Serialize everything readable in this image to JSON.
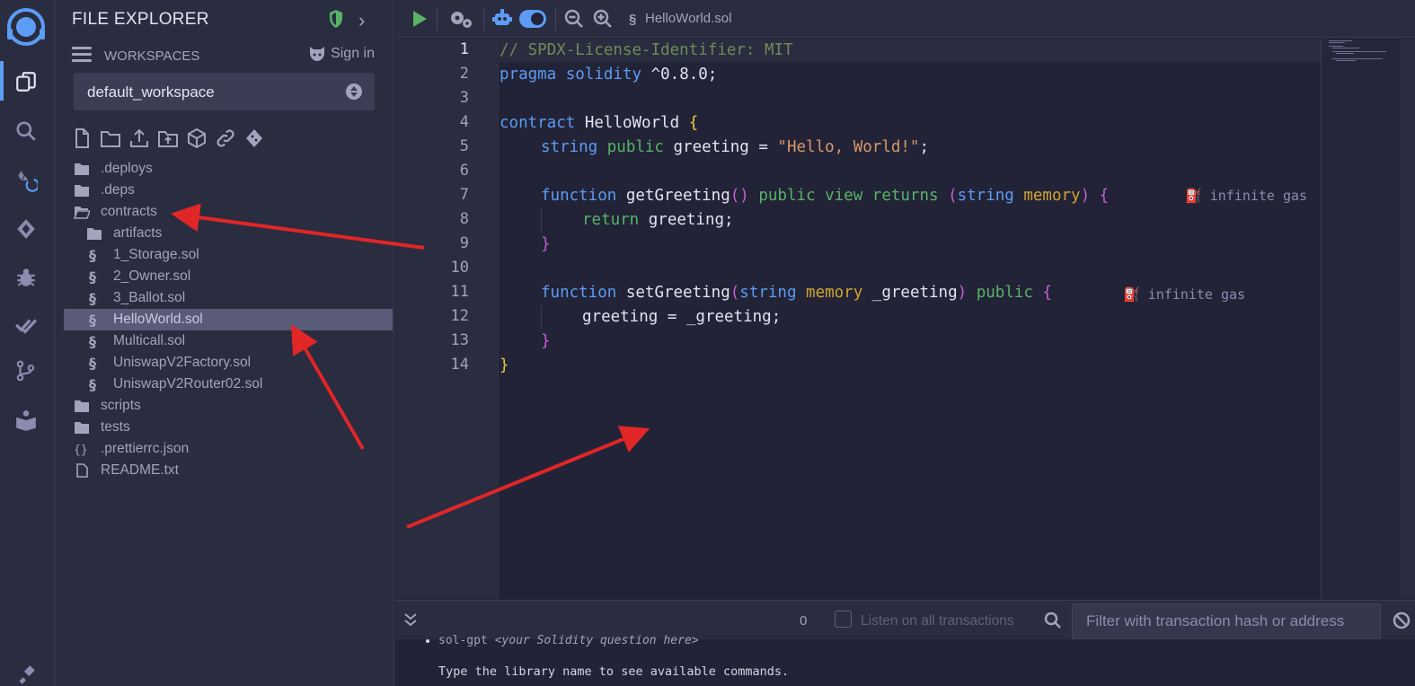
{
  "explorer": {
    "title": "FILE EXPLORER",
    "workspaces_label": "WORKSPACES",
    "sign_in": "Sign in",
    "workspace": "default_workspace"
  },
  "tree": [
    {
      "name": ".deploys",
      "type": "folder",
      "indent": 0
    },
    {
      "name": ".deps",
      "type": "folder",
      "indent": 0
    },
    {
      "name": "contracts",
      "type": "folder-open",
      "indent": 0
    },
    {
      "name": "artifacts",
      "type": "folder",
      "indent": 1
    },
    {
      "name": "1_Storage.sol",
      "type": "sol",
      "indent": 1
    },
    {
      "name": "2_Owner.sol",
      "type": "sol",
      "indent": 1
    },
    {
      "name": "3_Ballot.sol",
      "type": "sol",
      "indent": 1
    },
    {
      "name": "HelloWorld.sol",
      "type": "sol",
      "indent": 1,
      "selected": true
    },
    {
      "name": "Multicall.sol",
      "type": "sol",
      "indent": 1
    },
    {
      "name": "UniswapV2Factory.sol",
      "type": "sol",
      "indent": 1
    },
    {
      "name": "UniswapV2Router02.sol",
      "type": "sol",
      "indent": 1
    },
    {
      "name": "scripts",
      "type": "folder",
      "indent": 0
    },
    {
      "name": "tests",
      "type": "folder",
      "indent": 0
    },
    {
      "name": ".prettierrc.json",
      "type": "json",
      "indent": 0
    },
    {
      "name": "README.txt",
      "type": "file",
      "indent": 0
    }
  ],
  "topbar": {
    "tab_name": "HelloWorld.sol"
  },
  "editor": {
    "line_numbers": [
      "1",
      "2",
      "3",
      "4",
      "5",
      "6",
      "7",
      "8",
      "9",
      "10",
      "11",
      "12",
      "13",
      "14"
    ],
    "gas_label_1": "infinite gas",
    "gas_label_2": "infinite gas",
    "code": {
      "l1": "// SPDX-License-Identifier: MIT",
      "l2_kw": "pragma solidity",
      "l2_rest": " ^0.8.0;",
      "l4_kw": "contract",
      "l4_name": " HelloWorld ",
      "l4_brace": "{",
      "l5_type": "string",
      "l5_pub": " public",
      "l5_mid": " greeting = ",
      "l5_str": "\"Hello, World!\"",
      "l5_end": ";",
      "l7_fn": "function",
      "l7_name": " getGreeting",
      "l7_paren": "()",
      "l7_pub": " public view returns",
      "l7_open": " (",
      "l7_type": "string",
      "l7_mem": " memory",
      "l7_close": ")",
      "l7_brace": " {",
      "l8_ret": "return",
      "l8_rest": " greeting;",
      "l9": "}",
      "l11_fn": "function",
      "l11_name": " setGreeting",
      "l11_open": "(",
      "l11_type": "string",
      "l11_mem": " memory",
      "l11_arg": " _greeting",
      "l11_close": ")",
      "l11_pub": " public",
      "l11_brace": " {",
      "l12": "greeting = _greeting;",
      "l13": "}",
      "l14": "}"
    }
  },
  "terminal": {
    "tx_count": "0",
    "listen_label": "Listen on all transactions",
    "filter_placeholder": "Filter with transaction hash or address",
    "line1_cmd": "sol-gpt ",
    "line1_arg": "<your Solidity question here>",
    "line2": "Type the library name to see available commands."
  },
  "colors": {
    "background": "#222336",
    "panel": "#2a2c3f",
    "accent": "#5c9cf5",
    "annotation_arrow": "#e02626"
  }
}
